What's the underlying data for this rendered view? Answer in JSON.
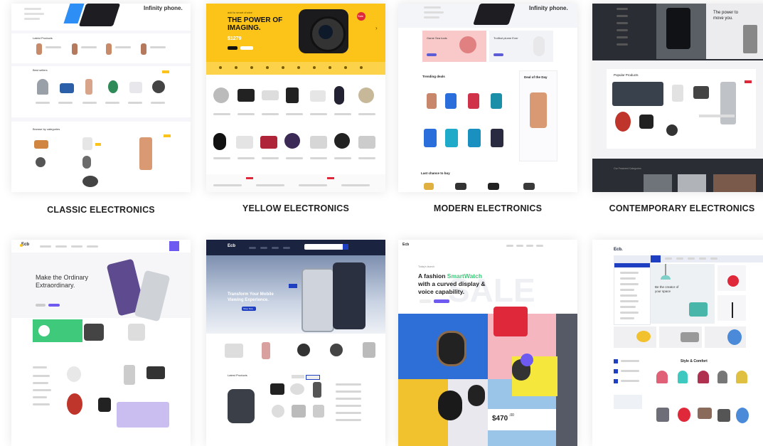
{
  "captions": {
    "classic": "CLASSIC ELECTRONICS",
    "yellow": "YELLOW ELECTRONICS",
    "modern": "MODERN ELECTRONICS",
    "contemporary": "CONTEMPORARY ELECTRONICS"
  },
  "classic": {
    "hero_text": "Infinity phone.",
    "latest_title": "Latest Products",
    "best_title": "Best sellers",
    "browse_title": "Browse by categories"
  },
  "yellow": {
    "hero_kicker": "add to smart choice",
    "hero_headline_1": "THE POWER OF",
    "hero_headline_2": "IMAGING.",
    "hero_price": "$1279",
    "hero_badge": "Sale"
  },
  "modern": {
    "hero_text": "Infinity phone.",
    "promo_1": "Game Sea tools",
    "promo_2": "Trollbot plume Ever",
    "trending_title": "Trending deals",
    "deal_title": "Deal of the Day",
    "last_chance_title": "Last chance to buy"
  },
  "contemporary": {
    "hero_text_1": "The power to",
    "hero_text_2": "move you.",
    "popular_title": "Popular Products",
    "footer_strip": "Our Featured Categories"
  },
  "bottom1": {
    "logo": "Ecb",
    "headline_1": "Make the Ordinary",
    "headline_2": "Extraordinary."
  },
  "bottom2": {
    "logo": "Ecb",
    "headline_1": "Transform Your Mobile",
    "headline_2": "Viewing Experience.",
    "cta": "Shop Now",
    "latest_title": "Latest Products"
  },
  "bottom3": {
    "logo": "Ecb",
    "kicker": "Today's launch",
    "headline_1a": "A fashion ",
    "headline_1b": "SmartWatch",
    "headline_2": "with a curved display &",
    "headline_3": "voice capability.",
    "bg_word": "SALE",
    "price": "$470",
    "price_cents": ".00",
    "accent": "#3ec97b"
  },
  "bottom4": {
    "logo": "Ecb.",
    "hero_text_1": "Be the creator of",
    "hero_text_2": "your space",
    "section_title": "Style & Comfort"
  },
  "colors": {
    "yellow": "#fcc419",
    "purple": "#6e5af0",
    "navy": "#1a2340",
    "blue_bar": "#1f3fc2",
    "dark": "#2a2d33",
    "red": "#e0283b"
  }
}
